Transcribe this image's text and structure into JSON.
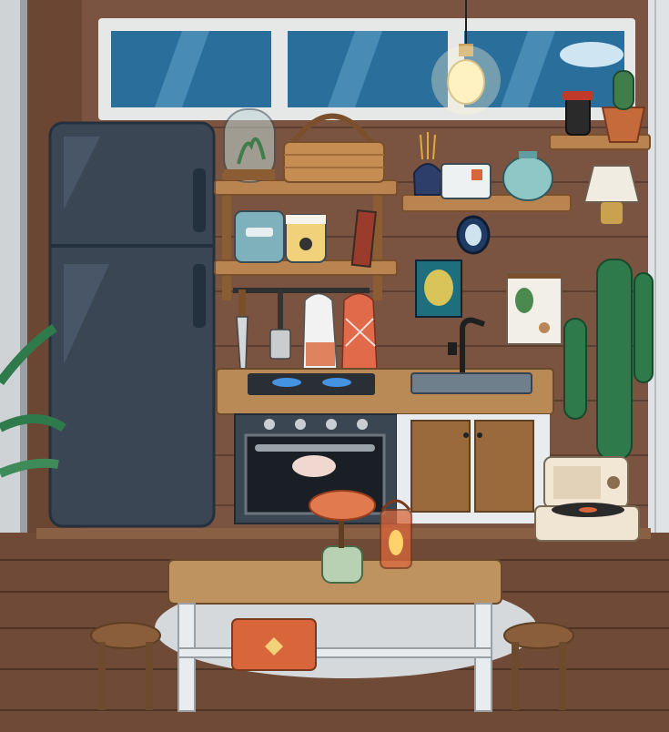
{
  "scene": {
    "name": "Kitchen room",
    "colors": {
      "wall": "#7a5440",
      "wall_plank_line": "#5e3f2f",
      "floor": "#6e4a37",
      "floor_plank_line": "#4f3425",
      "window_sky": "#2a6f9c",
      "window_frame": "#e6e8e8",
      "fridge": "#3b4654",
      "fridge_edge": "#23303d",
      "shelf_wood": "#b9844f",
      "counter_top": "#b98a55",
      "cabinet_wood": "#9a6a3c",
      "oven_steel": "#3a4652",
      "table_top": "#bf9360",
      "table_leg": "#e8ecef",
      "stool": "#8a5e3a",
      "cactus": "#2f7a4a",
      "accent_orange": "#d9663a",
      "rug": "#d6d9dc"
    }
  },
  "items": {
    "window": "window-icon",
    "pendant_lamp": "light-bulb-icon",
    "fridge": "fridge-icon",
    "terrarium": "terrarium-icon",
    "basket": "basket-icon",
    "jar": "jar-icon",
    "honey_jar": "honey-jar-icon",
    "book": "book-icon",
    "incense": "incense-icon",
    "photo_card": "card-icon",
    "teapot": "teapot-icon",
    "soy_sauce": "bottle-icon",
    "potted_cactus": "cactus-icon",
    "wall_lamp": "lamp-icon",
    "mirror": "mirror-icon",
    "poster": "poster-icon",
    "leaf_chart": "leaf-icon",
    "knife": "knife-icon",
    "spatula": "spatula-icon",
    "towel": "towel-icon",
    "stove": "stove-icon",
    "faucet": "faucet-icon",
    "sink": "sink-icon",
    "oven": "oven-icon",
    "cabinet": "cabinet-icon",
    "tall_cactus": "cactus-icon",
    "radio": "radio-icon",
    "record_player": "record-player-icon",
    "palm": "plant-icon",
    "table": "table-icon",
    "bonsai": "bonsai-icon",
    "lantern": "lantern-icon",
    "chest": "chest-icon",
    "stool_left": "stool-icon",
    "stool_right": "stool-icon"
  }
}
